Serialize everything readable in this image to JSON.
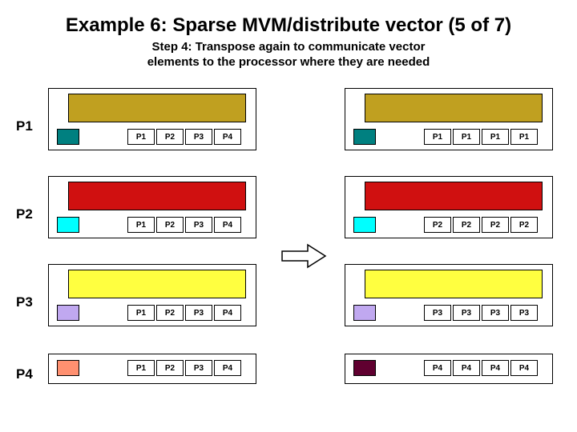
{
  "title": "Example 6: Sparse MVM/distribute vector (5 of 7)",
  "subtitle_line1": "Step 4: Transpose again to communicate vector",
  "subtitle_line2": "elements to the processor where they are needed",
  "row_labels": {
    "p1": "P1",
    "p2": "P2",
    "p3": "P3",
    "p4": "P4"
  },
  "left_cells": {
    "r1": [
      "P1",
      "P2",
      "P3",
      "P4"
    ],
    "r2": [
      "P1",
      "P2",
      "P3",
      "P4"
    ],
    "r3": [
      "P1",
      "P2",
      "P3",
      "P4"
    ],
    "r4": [
      "P1",
      "P2",
      "P3",
      "P4"
    ]
  },
  "right_cells": {
    "r1": [
      "P1",
      "P1",
      "P1",
      "P1"
    ],
    "r2": [
      "P2",
      "P2",
      "P2",
      "P2"
    ],
    "r3": [
      "P3",
      "P3",
      "P3",
      "P3"
    ],
    "r4": [
      "P4",
      "P4",
      "P4",
      "P4"
    ]
  },
  "chart_data": {
    "type": "table",
    "title": "Sparse MVM vector transpose: block ownership before and after step 4",
    "processors": [
      "P1",
      "P2",
      "P3",
      "P4"
    ],
    "left_panel_cells": [
      [
        "P1",
        "P2",
        "P3",
        "P4"
      ],
      [
        "P1",
        "P2",
        "P3",
        "P4"
      ],
      [
        "P1",
        "P2",
        "P3",
        "P4"
      ],
      [
        "P1",
        "P2",
        "P3",
        "P4"
      ]
    ],
    "right_panel_cells": [
      [
        "P1",
        "P1",
        "P1",
        "P1"
      ],
      [
        "P2",
        "P2",
        "P2",
        "P2"
      ],
      [
        "P3",
        "P3",
        "P3",
        "P3"
      ],
      [
        "P4",
        "P4",
        "P4",
        "P4"
      ]
    ],
    "row_bar_color": {
      "P1": "olive",
      "P2": "red",
      "P3": "yellow",
      "P4": "magenta"
    },
    "left_chip_color": {
      "P1": "teal",
      "P2": "cyan",
      "P3": "lavender",
      "P4": "salmon"
    },
    "right_chip_color": {
      "P1": "teal",
      "P2": "cyan",
      "P3": "lavender",
      "P4": "maroon"
    }
  }
}
